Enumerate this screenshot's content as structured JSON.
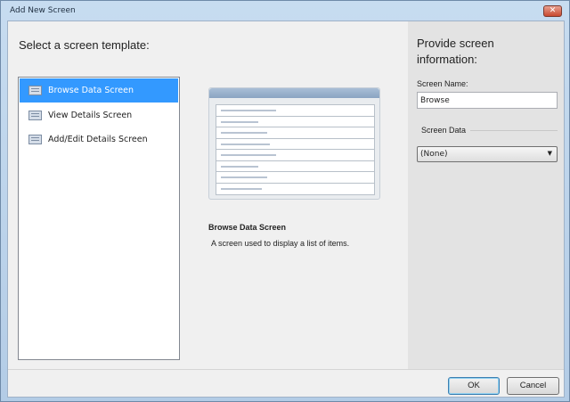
{
  "window": {
    "title": "Add New Screen",
    "close_label": "✕"
  },
  "left": {
    "heading": "Select a screen template:",
    "templates": [
      {
        "label": "Browse Data Screen",
        "selected": true
      },
      {
        "label": "View Details Screen",
        "selected": false
      },
      {
        "label": "Add/Edit Details Screen",
        "selected": false
      }
    ]
  },
  "preview": {
    "title": "Browse Data Screen",
    "description": "A screen used to display a list of items."
  },
  "right": {
    "heading_line1": "Provide screen",
    "heading_line2": "information:",
    "screen_name_label": "Screen Name:",
    "screen_name_value": "Browse",
    "screen_data_label": "Screen Data",
    "screen_data_value": "(None)"
  },
  "buttons": {
    "ok": "OK",
    "cancel": "Cancel"
  },
  "colors": {
    "selection": "#3399ff",
    "right_panel": "#e3e3e3"
  }
}
